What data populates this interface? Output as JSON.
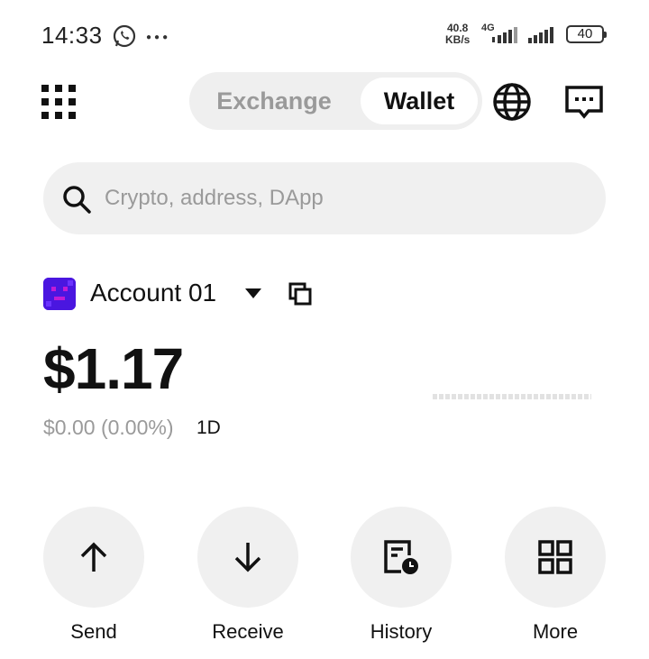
{
  "status_bar": {
    "time": "14:33",
    "icons": [
      "whatsapp-icon",
      "more-dots-icon"
    ],
    "net_speed_value": "40.8",
    "net_speed_unit": "KB/s",
    "network_type": "4G",
    "battery": "40"
  },
  "header": {
    "menu_icon": "grid-menu-icon",
    "tabs": [
      {
        "label": "Exchange",
        "active": false
      },
      {
        "label": "Wallet",
        "active": true
      }
    ],
    "globe_icon": "globe-icon",
    "chat_icon": "chat-icon"
  },
  "search": {
    "placeholder": "Crypto, address, DApp",
    "value": ""
  },
  "account": {
    "name": "Account 01",
    "avatar_color": "#4a16e0",
    "balance": "$1.17",
    "change": "$0.00 (0.00%)",
    "period": "1D"
  },
  "actions": [
    {
      "label": "Send",
      "icon": "arrow-up-icon"
    },
    {
      "label": "Receive",
      "icon": "arrow-down-icon"
    },
    {
      "label": "History",
      "icon": "history-icon"
    },
    {
      "label": "More",
      "icon": "apps-grid-icon"
    }
  ],
  "colors": {
    "accent_bg": "#f0f0f0",
    "muted_text": "#9a9a9a",
    "primary_text": "#111111"
  }
}
